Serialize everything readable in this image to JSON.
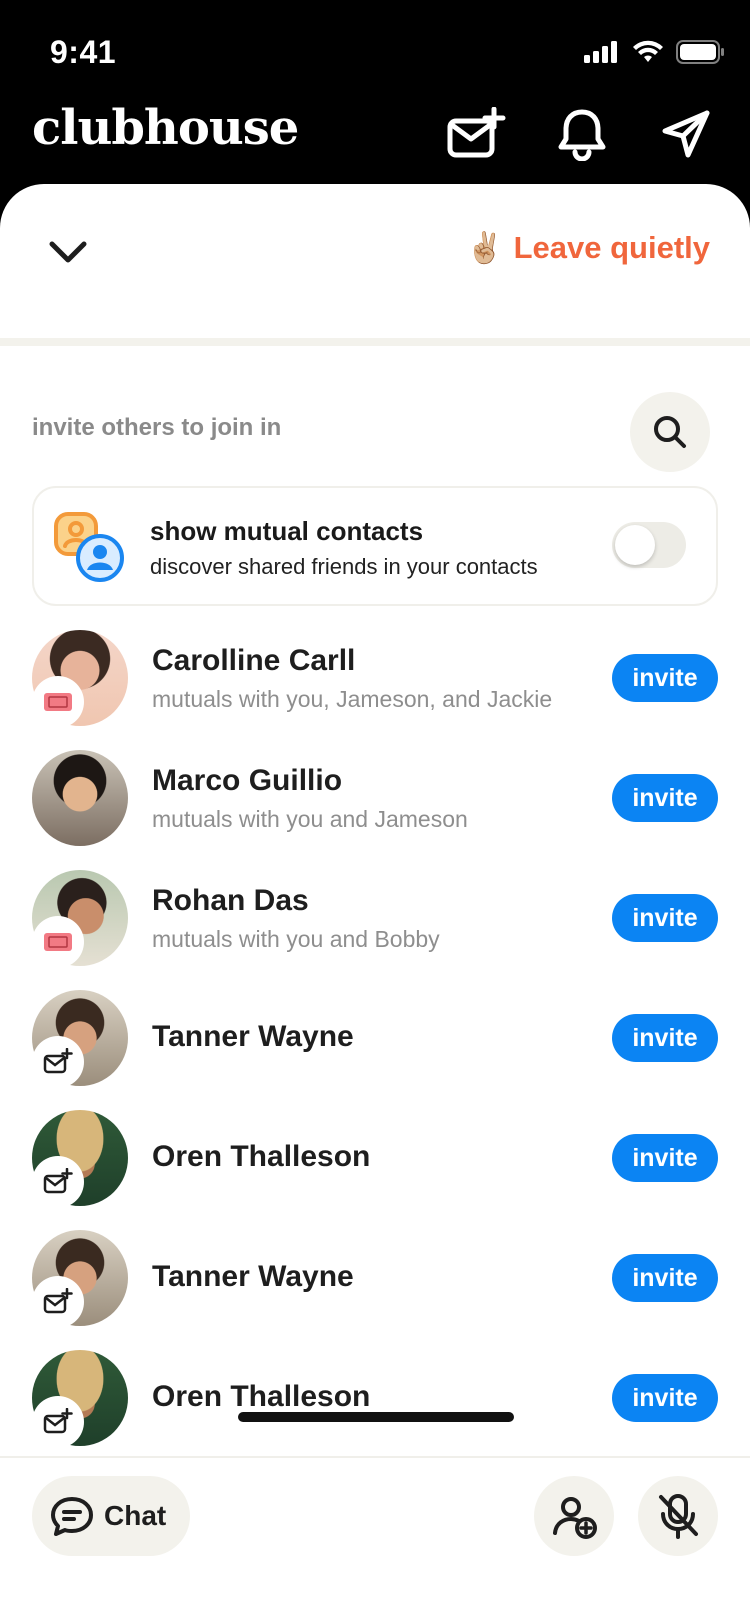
{
  "status": {
    "time": "9:41"
  },
  "header": {
    "brand": "clubhouse"
  },
  "sheet": {
    "leave_emoji": "✌🏼",
    "leave_label": "Leave quietly"
  },
  "invite": {
    "label": "invite others to join in"
  },
  "mutual": {
    "title": "show mutual contacts",
    "subtitle": "discover shared friends in your contacts",
    "enabled": false
  },
  "people": [
    {
      "name": "Carolline Carll",
      "sub": "mutuals with you, Jameson, and Jackie",
      "badge": "ticket",
      "button": "invite"
    },
    {
      "name": "Marco Guillio",
      "sub": "mutuals with you and Jameson",
      "badge": "none",
      "button": "invite"
    },
    {
      "name": "Rohan Das",
      "sub": "mutuals with you and Bobby",
      "badge": "ticket",
      "button": "invite"
    },
    {
      "name": "Tanner Wayne",
      "sub": "",
      "badge": "mail-plus",
      "button": "invite"
    },
    {
      "name": "Oren Thalleson",
      "sub": "",
      "badge": "mail-plus",
      "button": "invite"
    },
    {
      "name": "Tanner Wayne",
      "sub": "",
      "badge": "mail-plus",
      "button": "invite"
    },
    {
      "name": "Oren Thalleson",
      "sub": "",
      "badge": "mail-plus",
      "button": "invite"
    }
  ],
  "bottom": {
    "chat_label": "Chat"
  },
  "colors": {
    "accent": "#0B84F3",
    "leave": "#F0663C",
    "chip_bg": "#F3F2EC"
  }
}
